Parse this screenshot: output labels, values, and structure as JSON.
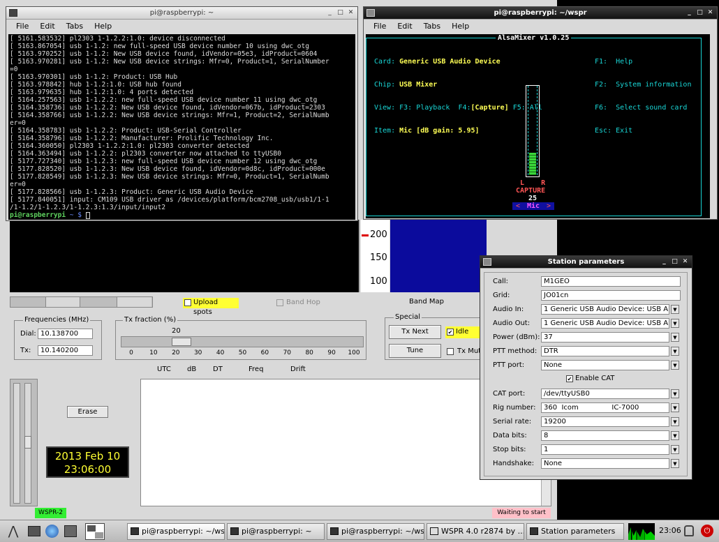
{
  "term1": {
    "title": "pi@raspberrypi: ~",
    "menu": [
      "File",
      "Edit",
      "Tabs",
      "Help"
    ],
    "lines": [
      "[ 5161.583532] pl2303 1-1.2.2:1.0: device disconnected",
      "[ 5163.867054] usb 1-1.2: new full-speed USB device number 10 using dwc_otg",
      "[ 5163.970252] usb 1-1.2: New USB device found, idVendor=05e3, idProduct=0604",
      "[ 5163.970281] usb 1-1.2: New USB device strings: Mfr=0, Product=1, SerialNumber",
      "=0",
      "[ 5163.970301] usb 1-1.2: Product: USB Hub",
      "[ 5163.978842] hub 1-1.2:1.0: USB hub found",
      "[ 5163.979635] hub 1-1.2:1.0: 4 ports detected",
      "[ 5164.257563] usb 1-1.2.2: new full-speed USB device number 11 using dwc_otg",
      "[ 5164.358736] usb 1-1.2.2: New USB device found, idVendor=067b, idProduct=2303",
      "[ 5164.358766] usb 1-1.2.2: New USB device strings: Mfr=1, Product=2, SerialNumb",
      "er=0",
      "[ 5164.358783] usb 1-1.2.2: Product: USB-Serial Controller",
      "[ 5164.358796] usb 1-1.2.2: Manufacturer: Prolific Technology Inc.",
      "[ 5164.360050] pl2303 1-1.2.2:1.0: pl2303 converter detected",
      "[ 5164.363494] usb 1-1.2.2: pl2303 converter now attached to ttyUSB0",
      "[ 5177.727340] usb 1-1.2.3: new full-speed USB device number 12 using dwc_otg",
      "[ 5177.828520] usb 1-1.2.3: New USB device found, idVendor=0d8c, idProduct=000e",
      "[ 5177.828549] usb 1-1.2.3: New USB device strings: Mfr=0, Product=1, SerialNumb",
      "er=0",
      "[ 5177.828566] usb 1-1.2.3: Product: Generic USB Audio Device",
      "[ 5177.840051] input: CM109 USB driver as /devices/platform/bcm2708_usb/usb1/1-1",
      "/1-1.2/1-1.2.3/1-1.2.3:1.3/input/input2"
    ],
    "prompt": "pi@raspberrypi",
    "prompt_suffix": " ~ $ "
  },
  "term2": {
    "title": "pi@raspberrypi: ~/wspr",
    "menu": [
      "File",
      "Edit",
      "Tabs",
      "Help"
    ],
    "alsamixer": {
      "header": "AlsaMixer v1.0.25",
      "card_label": "Card:",
      "card": "Generic USB Audio Device",
      "chip_label": "Chip:",
      "chip": "USB Mixer",
      "view_label": "View:",
      "view_f3": "F3: Playback",
      "view_f4_key": "F4:",
      "view_f4": "[Capture]",
      "view_f5": "F5: All",
      "item_label": "Item:",
      "item": "Mic [dB gain: 5.95]",
      "help": [
        "F1:  Help",
        "F2:  System information",
        "F6:  Select sound card",
        "Esc: Exit"
      ],
      "level_percent": 25,
      "lr": "L    R",
      "capture": "CAPTURE",
      "capture_value": "25",
      "channel": "Mic"
    }
  },
  "wspr": {
    "waterfall_scale": [
      "200",
      "150",
      "100"
    ],
    "upload_spots": "Upload spots",
    "band_hop": "Band Hop",
    "band_map": "Band Map",
    "frequencies_title": "Frequencies (MHz)",
    "dial_label": "Dial:",
    "dial": "10.138700",
    "tx_label": "Tx:",
    "tx": "10.140200",
    "tx_fraction_title": "Tx fraction (%)",
    "tx_fraction_value": "20",
    "tx_fraction_level": 20,
    "tx_fraction_ticks": [
      "0",
      "10",
      "20",
      "30",
      "40",
      "50",
      "60",
      "70",
      "80",
      "90",
      "100"
    ],
    "special_title": "Special",
    "tx_next": "Tx Next",
    "idle": "Idle",
    "tune": "Tune",
    "tx_mute": "Tx Mute",
    "columns": [
      "UTC",
      "dB",
      "DT",
      "Freq",
      "Drift"
    ],
    "erase": "Erase",
    "date": "2013 Feb 10",
    "time": "23:06:00",
    "mode": "WSPR-2",
    "status": "Waiting to start"
  },
  "station": {
    "title": "Station parameters",
    "fields": [
      {
        "label": "Call:",
        "value": "M1GEO",
        "dropdown": false
      },
      {
        "label": "Grid:",
        "value": "JO01cn",
        "dropdown": false
      },
      {
        "label": "Audio In:",
        "value": "1 Generic USB Audio Device: USB Aud",
        "dropdown": true
      },
      {
        "label": "Audio Out:",
        "value": "1 Generic USB Audio Device: USB Aud",
        "dropdown": true
      },
      {
        "label": "Power (dBm):",
        "value": "37",
        "dropdown": true
      },
      {
        "label": "PTT method:",
        "value": "DTR",
        "dropdown": true
      },
      {
        "label": "PTT port:",
        "value": "None",
        "dropdown": true
      }
    ],
    "enable_cat": "Enable CAT",
    "cat_fields": [
      {
        "label": "CAT port:",
        "value": "/dev/ttyUSB0"
      },
      {
        "label": "Rig number:",
        "value": "360  Icom               IC-7000"
      },
      {
        "label": "Serial rate:",
        "value": "19200"
      },
      {
        "label": "Data bits:",
        "value": "8"
      },
      {
        "label": "Stop bits:",
        "value": "1"
      },
      {
        "label": "Handshake:",
        "value": "None"
      }
    ]
  },
  "taskbar": {
    "tasks": [
      "pi@raspberrypi: ~/wspr",
      "pi@raspberrypi: ~",
      "pi@raspberrypi: ~/wspr",
      "WSPR 4.0 r2874   by ...",
      "Station parameters"
    ],
    "clock": "23:06"
  }
}
